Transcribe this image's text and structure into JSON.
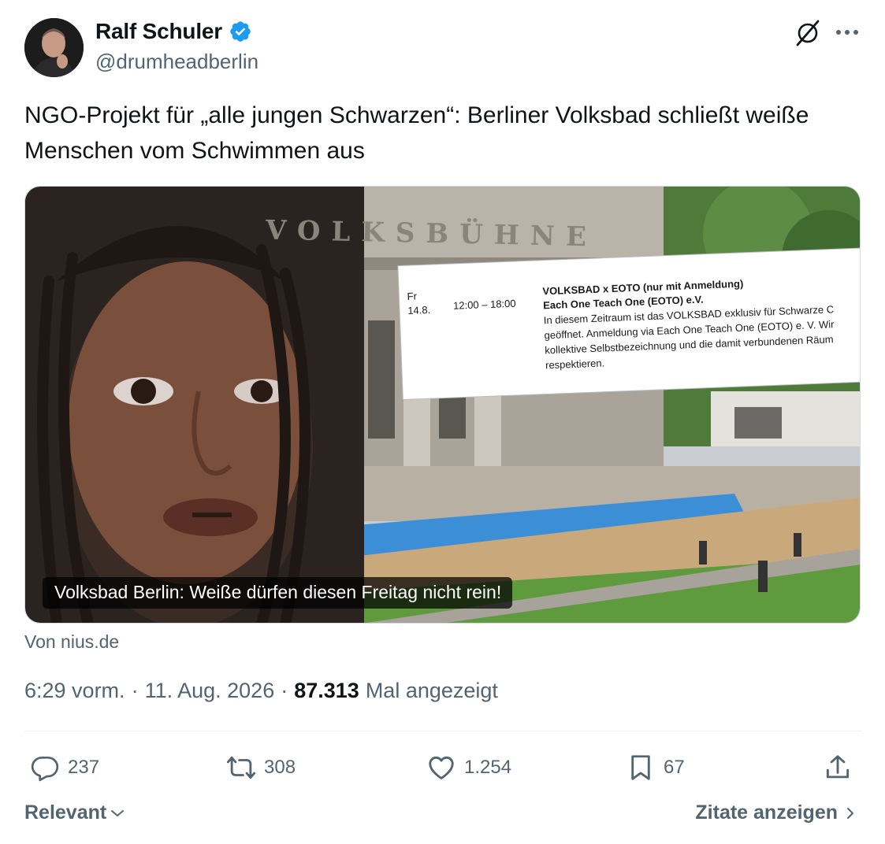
{
  "author": {
    "display_name": "Ralf Schuler",
    "handle": "@drumheadberlin",
    "verified": true
  },
  "icons": {
    "avatar": "profile-photo",
    "verified": "verified-badge-icon",
    "grok": "grok-icon",
    "more": "more-dots-icon",
    "reply": "reply-icon",
    "retweet": "retweet-icon",
    "like": "heart-icon",
    "bookmark": "bookmark-icon",
    "share": "share-icon"
  },
  "tweet": {
    "text": "NGO-Projekt für „alle jungen Schwarzen“: Berliner Volksbad schließt weiße Menschen vom Schwimmen aus"
  },
  "media": {
    "caption": "Volksbad Berlin: Weiße dürfen diesen Freitag nicht rein!",
    "building_sign": "VOLKSBÜHNE",
    "notice": {
      "day": "Fr",
      "date": "14.8.",
      "time": "12:00 – 18:00",
      "title": "VOLKSBAD x EOTO (nur mit Anmeldung)",
      "org": "Each One Teach One (EOTO) e.V.",
      "line1": "In diesem Zeitraum ist das VOLKSBAD exklusiv für Schwarze C",
      "line2": "geöffnet. Anmeldung via Each One Teach One (EOTO) e. V. Wir",
      "line3": "kollektive Selbstbezeichnung und die damit verbundenen Räum",
      "line4": "respektieren."
    }
  },
  "source": "Von nius.de",
  "meta": {
    "time": "6:29 vorm.",
    "separator": "·",
    "date": "11. Aug. 2026",
    "views": "87.313",
    "views_label": "Mal angezeigt"
  },
  "actions": {
    "replies": "237",
    "retweets": "308",
    "likes": "1.254",
    "bookmarks": "67"
  },
  "footer": {
    "sort_label": "Relevant",
    "quotes_label": "Zitate anzeigen"
  },
  "colors": {
    "text": "#0f1419",
    "secondary": "#536471",
    "verified": "#1d9bf0",
    "divider": "#eff3f4"
  }
}
